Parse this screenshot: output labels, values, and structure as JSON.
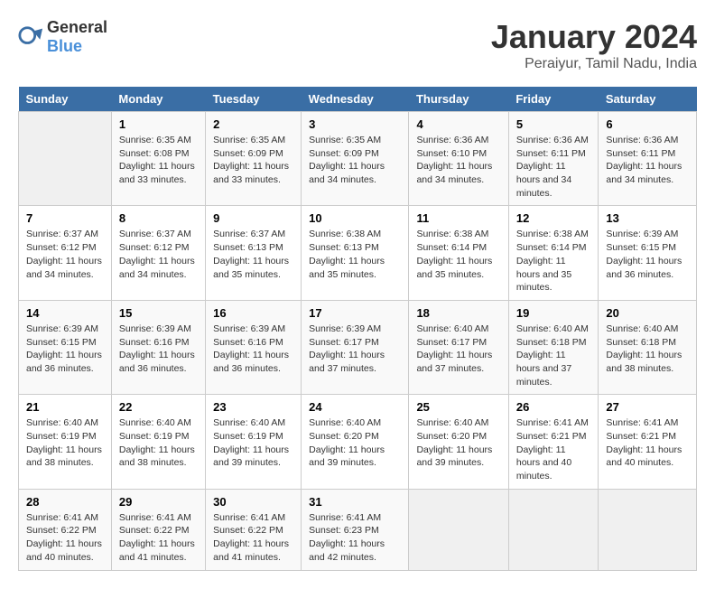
{
  "header": {
    "logo_general": "General",
    "logo_blue": "Blue",
    "title": "January 2024",
    "subtitle": "Peraiyur, Tamil Nadu, India"
  },
  "calendar": {
    "days_of_week": [
      "Sunday",
      "Monday",
      "Tuesday",
      "Wednesday",
      "Thursday",
      "Friday",
      "Saturday"
    ],
    "weeks": [
      [
        {
          "day": "",
          "empty": true
        },
        {
          "day": "1",
          "sunrise": "Sunrise: 6:35 AM",
          "sunset": "Sunset: 6:08 PM",
          "daylight": "Daylight: 11 hours and 33 minutes."
        },
        {
          "day": "2",
          "sunrise": "Sunrise: 6:35 AM",
          "sunset": "Sunset: 6:09 PM",
          "daylight": "Daylight: 11 hours and 33 minutes."
        },
        {
          "day": "3",
          "sunrise": "Sunrise: 6:35 AM",
          "sunset": "Sunset: 6:09 PM",
          "daylight": "Daylight: 11 hours and 34 minutes."
        },
        {
          "day": "4",
          "sunrise": "Sunrise: 6:36 AM",
          "sunset": "Sunset: 6:10 PM",
          "daylight": "Daylight: 11 hours and 34 minutes."
        },
        {
          "day": "5",
          "sunrise": "Sunrise: 6:36 AM",
          "sunset": "Sunset: 6:11 PM",
          "daylight": "Daylight: 11 hours and 34 minutes."
        },
        {
          "day": "6",
          "sunrise": "Sunrise: 6:36 AM",
          "sunset": "Sunset: 6:11 PM",
          "daylight": "Daylight: 11 hours and 34 minutes."
        }
      ],
      [
        {
          "day": "7",
          "sunrise": "Sunrise: 6:37 AM",
          "sunset": "Sunset: 6:12 PM",
          "daylight": "Daylight: 11 hours and 34 minutes."
        },
        {
          "day": "8",
          "sunrise": "Sunrise: 6:37 AM",
          "sunset": "Sunset: 6:12 PM",
          "daylight": "Daylight: 11 hours and 34 minutes."
        },
        {
          "day": "9",
          "sunrise": "Sunrise: 6:37 AM",
          "sunset": "Sunset: 6:13 PM",
          "daylight": "Daylight: 11 hours and 35 minutes."
        },
        {
          "day": "10",
          "sunrise": "Sunrise: 6:38 AM",
          "sunset": "Sunset: 6:13 PM",
          "daylight": "Daylight: 11 hours and 35 minutes."
        },
        {
          "day": "11",
          "sunrise": "Sunrise: 6:38 AM",
          "sunset": "Sunset: 6:14 PM",
          "daylight": "Daylight: 11 hours and 35 minutes."
        },
        {
          "day": "12",
          "sunrise": "Sunrise: 6:38 AM",
          "sunset": "Sunset: 6:14 PM",
          "daylight": "Daylight: 11 hours and 35 minutes."
        },
        {
          "day": "13",
          "sunrise": "Sunrise: 6:39 AM",
          "sunset": "Sunset: 6:15 PM",
          "daylight": "Daylight: 11 hours and 36 minutes."
        }
      ],
      [
        {
          "day": "14",
          "sunrise": "Sunrise: 6:39 AM",
          "sunset": "Sunset: 6:15 PM",
          "daylight": "Daylight: 11 hours and 36 minutes."
        },
        {
          "day": "15",
          "sunrise": "Sunrise: 6:39 AM",
          "sunset": "Sunset: 6:16 PM",
          "daylight": "Daylight: 11 hours and 36 minutes."
        },
        {
          "day": "16",
          "sunrise": "Sunrise: 6:39 AM",
          "sunset": "Sunset: 6:16 PM",
          "daylight": "Daylight: 11 hours and 36 minutes."
        },
        {
          "day": "17",
          "sunrise": "Sunrise: 6:39 AM",
          "sunset": "Sunset: 6:17 PM",
          "daylight": "Daylight: 11 hours and 37 minutes."
        },
        {
          "day": "18",
          "sunrise": "Sunrise: 6:40 AM",
          "sunset": "Sunset: 6:17 PM",
          "daylight": "Daylight: 11 hours and 37 minutes."
        },
        {
          "day": "19",
          "sunrise": "Sunrise: 6:40 AM",
          "sunset": "Sunset: 6:18 PM",
          "daylight": "Daylight: 11 hours and 37 minutes."
        },
        {
          "day": "20",
          "sunrise": "Sunrise: 6:40 AM",
          "sunset": "Sunset: 6:18 PM",
          "daylight": "Daylight: 11 hours and 38 minutes."
        }
      ],
      [
        {
          "day": "21",
          "sunrise": "Sunrise: 6:40 AM",
          "sunset": "Sunset: 6:19 PM",
          "daylight": "Daylight: 11 hours and 38 minutes."
        },
        {
          "day": "22",
          "sunrise": "Sunrise: 6:40 AM",
          "sunset": "Sunset: 6:19 PM",
          "daylight": "Daylight: 11 hours and 38 minutes."
        },
        {
          "day": "23",
          "sunrise": "Sunrise: 6:40 AM",
          "sunset": "Sunset: 6:19 PM",
          "daylight": "Daylight: 11 hours and 39 minutes."
        },
        {
          "day": "24",
          "sunrise": "Sunrise: 6:40 AM",
          "sunset": "Sunset: 6:20 PM",
          "daylight": "Daylight: 11 hours and 39 minutes."
        },
        {
          "day": "25",
          "sunrise": "Sunrise: 6:40 AM",
          "sunset": "Sunset: 6:20 PM",
          "daylight": "Daylight: 11 hours and 39 minutes."
        },
        {
          "day": "26",
          "sunrise": "Sunrise: 6:41 AM",
          "sunset": "Sunset: 6:21 PM",
          "daylight": "Daylight: 11 hours and 40 minutes."
        },
        {
          "day": "27",
          "sunrise": "Sunrise: 6:41 AM",
          "sunset": "Sunset: 6:21 PM",
          "daylight": "Daylight: 11 hours and 40 minutes."
        }
      ],
      [
        {
          "day": "28",
          "sunrise": "Sunrise: 6:41 AM",
          "sunset": "Sunset: 6:22 PM",
          "daylight": "Daylight: 11 hours and 40 minutes."
        },
        {
          "day": "29",
          "sunrise": "Sunrise: 6:41 AM",
          "sunset": "Sunset: 6:22 PM",
          "daylight": "Daylight: 11 hours and 41 minutes."
        },
        {
          "day": "30",
          "sunrise": "Sunrise: 6:41 AM",
          "sunset": "Sunset: 6:22 PM",
          "daylight": "Daylight: 11 hours and 41 minutes."
        },
        {
          "day": "31",
          "sunrise": "Sunrise: 6:41 AM",
          "sunset": "Sunset: 6:23 PM",
          "daylight": "Daylight: 11 hours and 42 minutes."
        },
        {
          "day": "",
          "empty": true
        },
        {
          "day": "",
          "empty": true
        },
        {
          "day": "",
          "empty": true
        }
      ]
    ]
  }
}
